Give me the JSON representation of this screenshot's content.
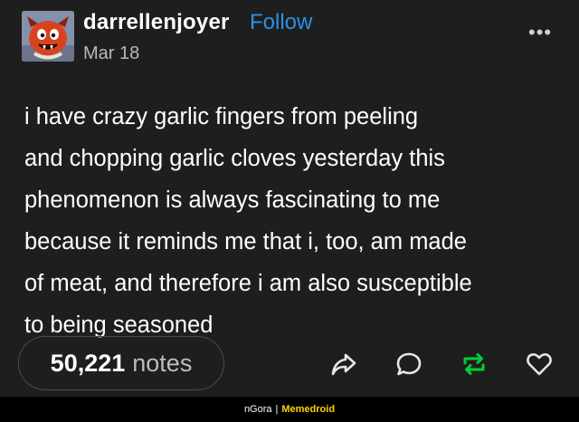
{
  "post": {
    "username": "darrellenjoyer",
    "follow_label": "Follow",
    "date": "Mar 18",
    "more_label": "•••",
    "lines": [
      "i have crazy garlic fingers from peeling",
      "and chopping garlic cloves yesterday this",
      "phenomenon is always fascinating to me",
      "because it reminds me that i, too, am made",
      "of meat, and therefore i am also susceptible",
      "to being seasoned"
    ],
    "notes_count": "50,221",
    "notes_label": "notes"
  },
  "actions": {
    "share_icon": "share-icon",
    "reply_icon": "reply-icon",
    "reblog_icon": "reblog-icon",
    "like_icon": "heart-icon",
    "reblog_color": "#00cf35",
    "icon_color": "#e6e6e6"
  },
  "footer": {
    "user": "nGora",
    "separator": "|",
    "site": "Memedroid"
  },
  "colors": {
    "background": "#1e1e1e",
    "accent": "#2e8fe6",
    "watermark": "#ffd400"
  }
}
